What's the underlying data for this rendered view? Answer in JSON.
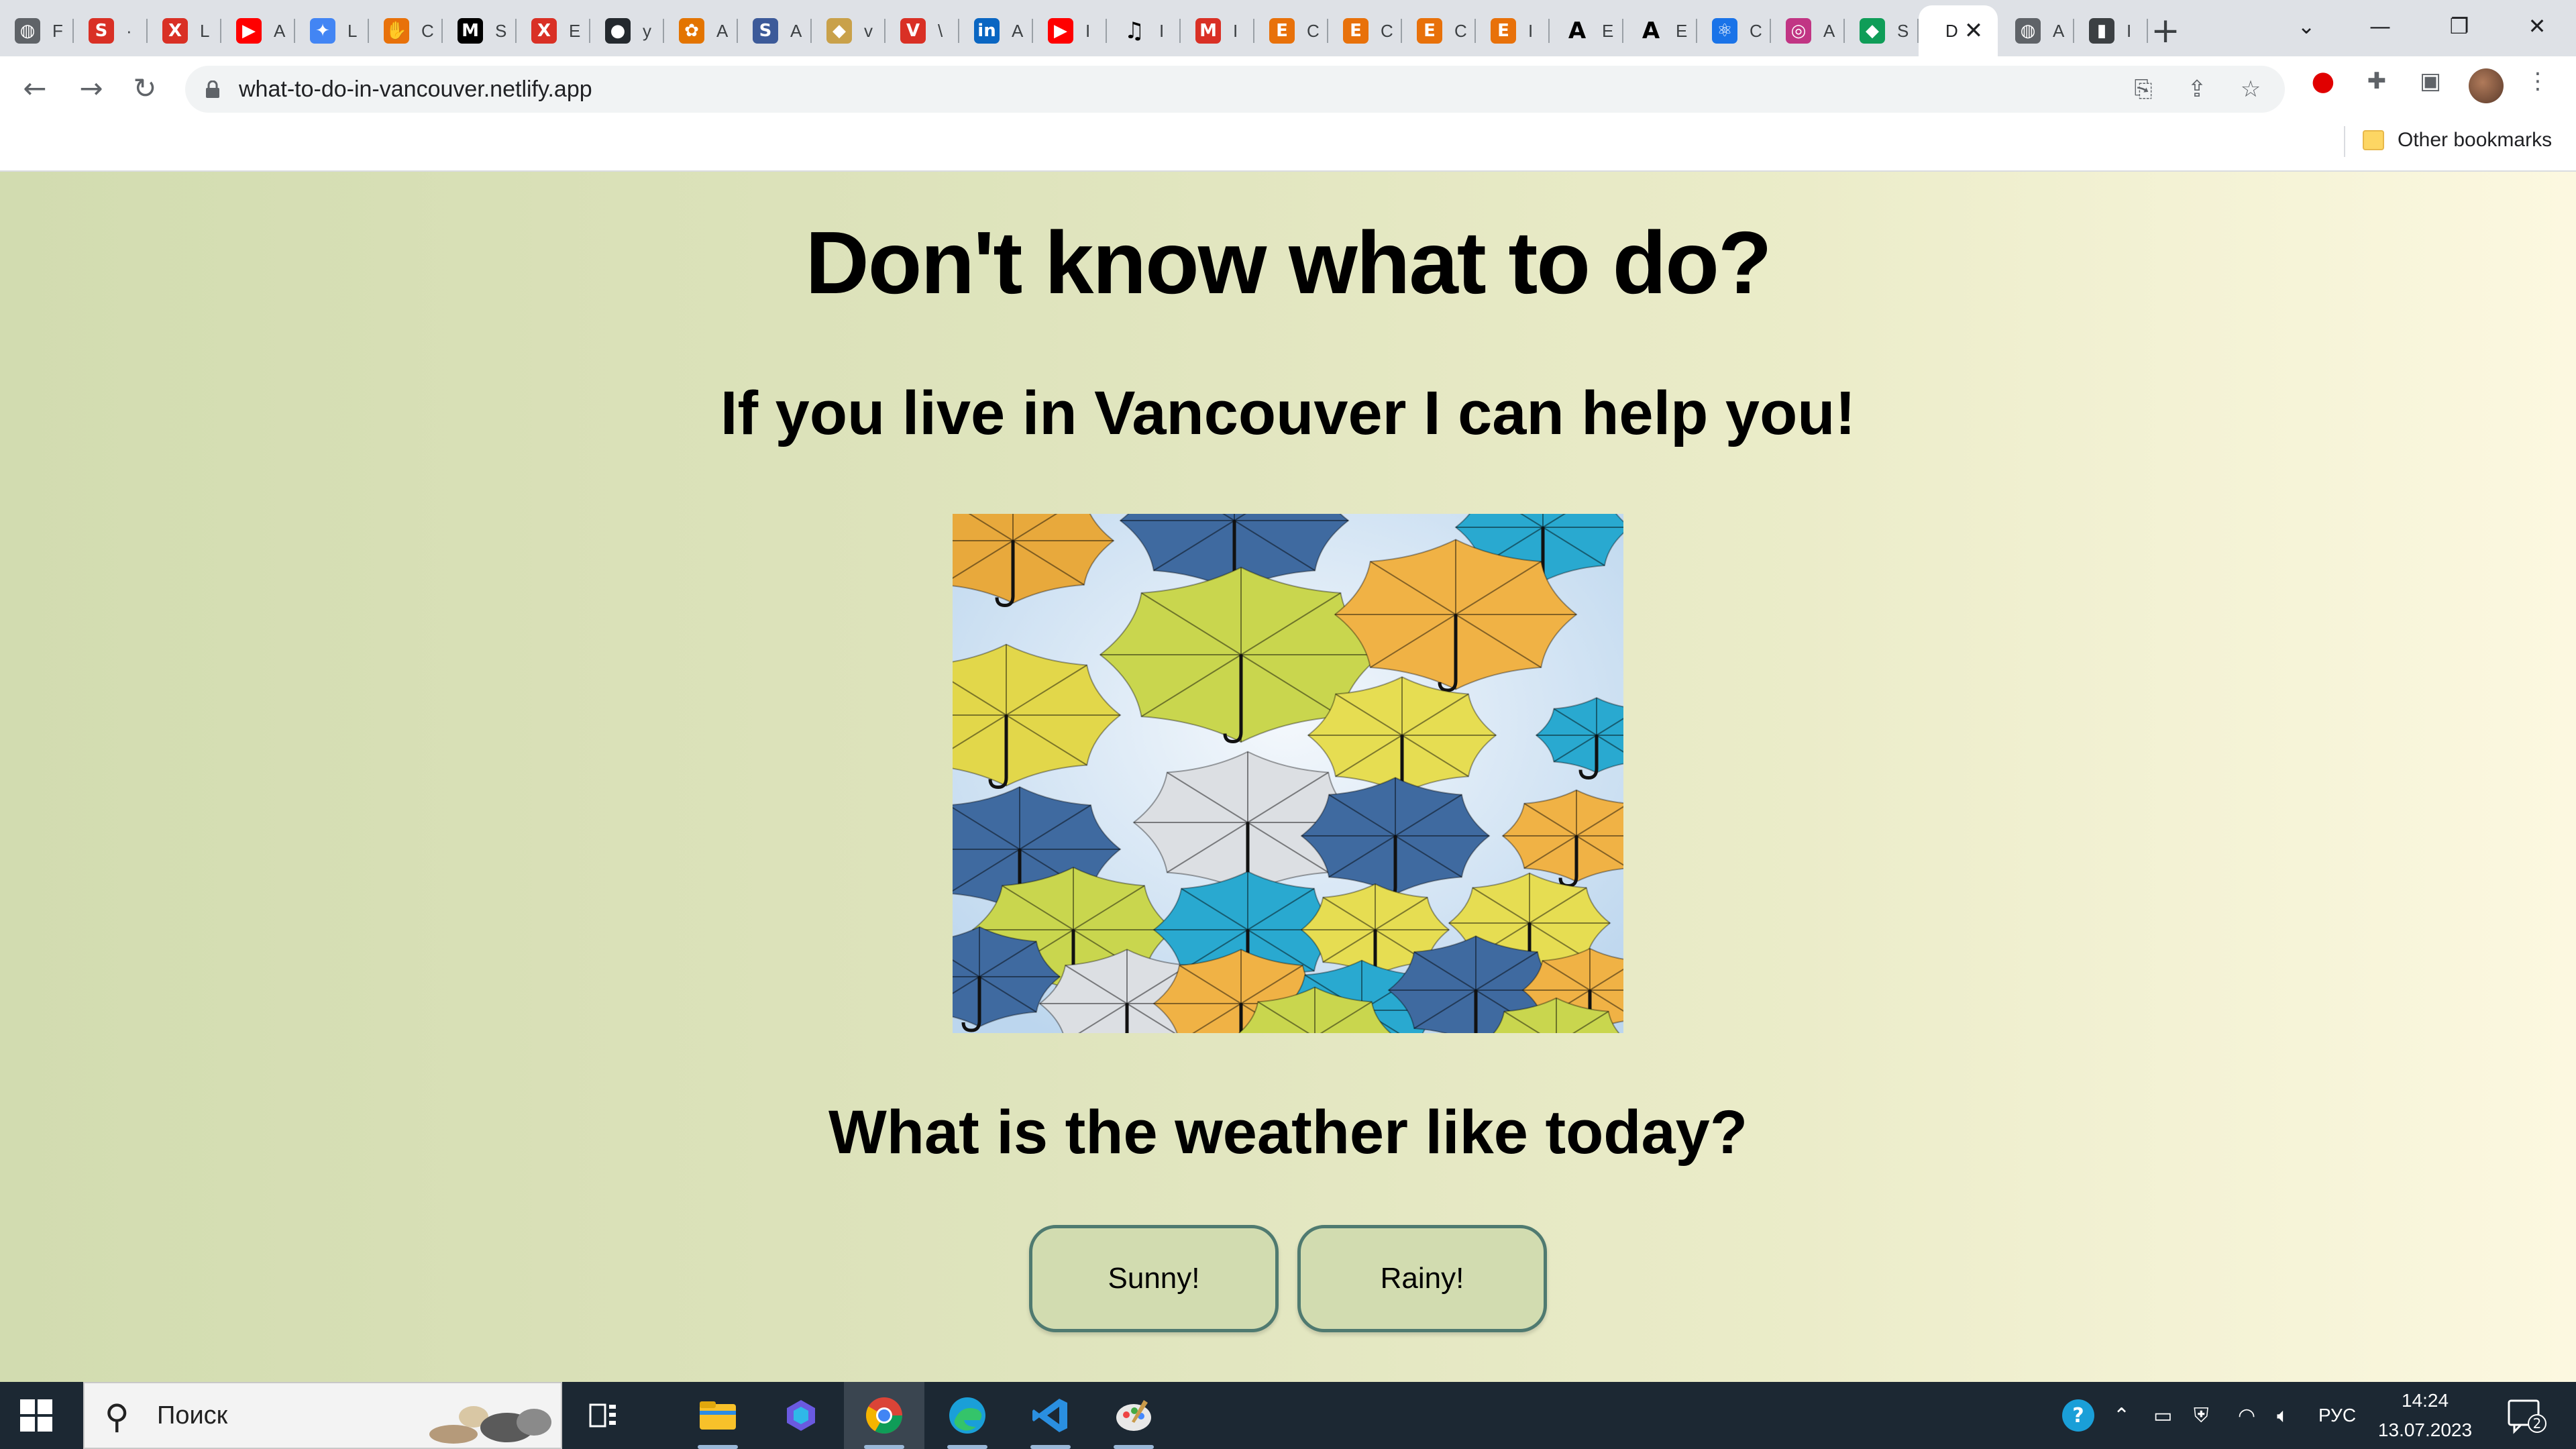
{
  "browser": {
    "tabs": [
      {
        "title": "F",
        "icon": "globe-icon",
        "color": "#5f6368"
      },
      {
        "title": "·",
        "icon": "s-logo-icon",
        "color": "#d93025"
      },
      {
        "title": "L",
        "icon": "figure-icon",
        "color": "#d93025"
      },
      {
        "title": "A",
        "icon": "youtube-icon",
        "color": "#ff0000"
      },
      {
        "title": "L",
        "icon": "puzzle-icon",
        "color": "#4285f4"
      },
      {
        "title": "C",
        "icon": "hand-icon",
        "color": "#e8710a"
      },
      {
        "title": "S",
        "icon": "m-logo-icon",
        "color": "#000000"
      },
      {
        "title": "E",
        "icon": "figure-icon",
        "color": "#d93025"
      },
      {
        "title": "y",
        "icon": "github-icon",
        "color": "#24292e"
      },
      {
        "title": "A",
        "icon": "flower-icon",
        "color": "#e37400"
      },
      {
        "title": "A",
        "icon": "s-circle-icon",
        "color": "#3c5a99"
      },
      {
        "title": "v",
        "icon": "doge-icon",
        "color": "#c9a14a"
      },
      {
        "title": "\\",
        "icon": "v-logo-icon",
        "color": "#d93025"
      },
      {
        "title": "A",
        "icon": "linkedin-icon",
        "color": "#0a66c2"
      },
      {
        "title": "I",
        "icon": "youtube-icon",
        "color": "#ff0000"
      },
      {
        "title": "I",
        "icon": "music-icon",
        "color": "#000000"
      },
      {
        "title": "I",
        "icon": "m-circle-icon",
        "color": "#d93025"
      },
      {
        "title": "C",
        "icon": "e-logo-icon",
        "color": "#e8710a"
      },
      {
        "title": "C",
        "icon": "e-logo-icon",
        "color": "#e8710a"
      },
      {
        "title": "C",
        "icon": "e-logo-icon",
        "color": "#e8710a"
      },
      {
        "title": "I",
        "icon": "e-logo-icon",
        "color": "#e8710a"
      },
      {
        "title": "E",
        "icon": "a-letter-icon",
        "color": "#000000"
      },
      {
        "title": "E",
        "icon": "a-letter-icon",
        "color": "#000000"
      },
      {
        "title": "C",
        "icon": "react-icon",
        "color": "#1a73e8"
      },
      {
        "title": "A",
        "icon": "instagram-icon",
        "color": "#c13584"
      },
      {
        "title": "S",
        "icon": "diamond-icon",
        "color": "#0f9d58"
      },
      {
        "title": "D",
        "icon": "none",
        "color": "#ffffff",
        "active": true
      },
      {
        "title": "A",
        "icon": "globe-icon",
        "color": "#5f6368"
      },
      {
        "title": "I",
        "icon": "book-icon",
        "color": "#3c4043"
      }
    ],
    "url": "what-to-do-in-vancouver.netlify.app",
    "other_bookmarks": "Other bookmarks"
  },
  "page": {
    "title": "Don't know what to do?",
    "subtitle": "If you live in Vancouver I can help you!",
    "image_alt": "umbrellas-photo",
    "question": "What is the weather like today?",
    "buttons": {
      "sunny": "Sunny!",
      "rainy": "Rainy!"
    }
  },
  "taskbar": {
    "search_placeholder": "Поиск",
    "language": "РУС",
    "time": "14:24",
    "date": "13.07.2023",
    "notifications_count": "2"
  }
}
